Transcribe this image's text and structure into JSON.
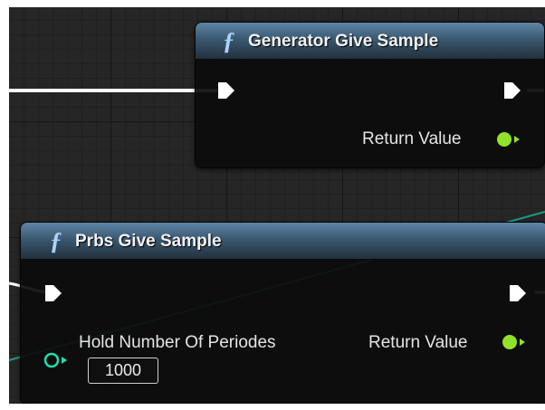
{
  "nodes": {
    "generator_give_sample": {
      "title": "Generator Give Sample",
      "icon": "function-icon",
      "output_label": "Return Value"
    },
    "prbs_give_sample": {
      "title": "Prbs Give Sample",
      "icon": "function-icon",
      "input_label": "Hold Number Of Periodes",
      "input_value": "1000",
      "output_label": "Return Value"
    }
  },
  "colors": {
    "exec_wire": "#ffffff",
    "bool_pin": "#92e22a",
    "int_pin": "#1fe0ad",
    "int_wire": "#1c9c7f",
    "node_header": "#4a6c88",
    "function_icon": "#a9d2ff"
  }
}
